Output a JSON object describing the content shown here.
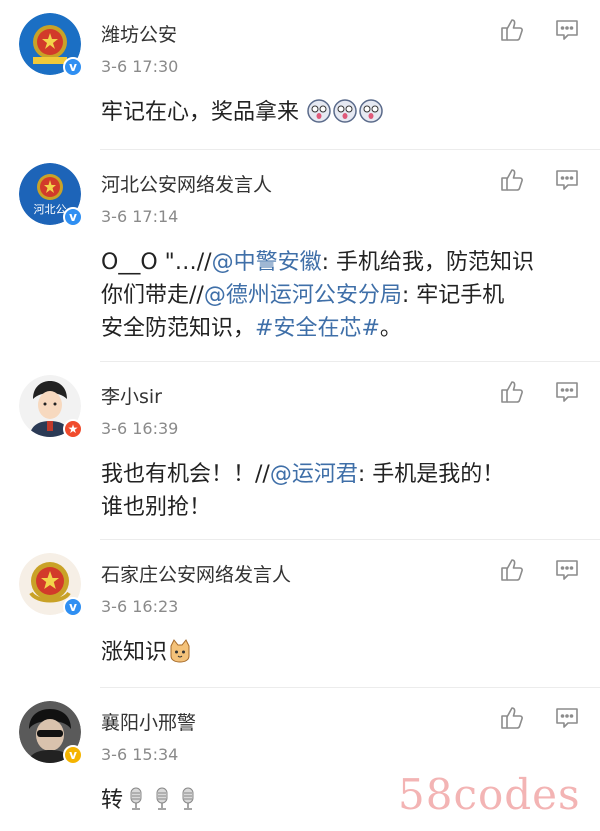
{
  "comments": [
    {
      "username": "潍坊公安",
      "time": "3-6 17:30",
      "content": [
        "牢记在心，奖品拿来"
      ],
      "badge": "v"
    },
    {
      "username": "河北公安网络发言人",
      "time": "3-6 17:14",
      "content_parts": {
        "a": "O__O \"…//",
        "b": "@中警安徽",
        "c": ": 手机给我，防范知识",
        "d": "你们带走//",
        "e": "@德州运河公安分局",
        "f": ": 牢记手机",
        "g": "安全防范知识，",
        "h": "#安全在芯#",
        "i": "。"
      },
      "avatar_text": "河北公",
      "badge": "v"
    },
    {
      "username": "李小sir",
      "time": "3-6 16:39",
      "content_parts": {
        "a": "我也有机会！！//",
        "b": "@运河君",
        "c": ": 手机是我的！",
        "d": "谁也别抢！"
      },
      "badge": "star"
    },
    {
      "username": "石家庄公安网络发言人",
      "time": "3-6 16:23",
      "content": [
        "涨知识"
      ],
      "badge": "v"
    },
    {
      "username": "襄阳小邢警",
      "time": "3-6 15:34",
      "content": [
        "转"
      ],
      "badge": "v"
    }
  ],
  "badges": {
    "v": "v",
    "star": "★"
  },
  "colors": {
    "link": "#3f6fa8",
    "verified_blue": "#2f8ff2",
    "verified_gold": "#f5b400",
    "star_red": "#f04b2c"
  },
  "icons": {
    "like": "thumbs-up-icon",
    "reply": "comment-icon"
  },
  "watermark": "58codes"
}
